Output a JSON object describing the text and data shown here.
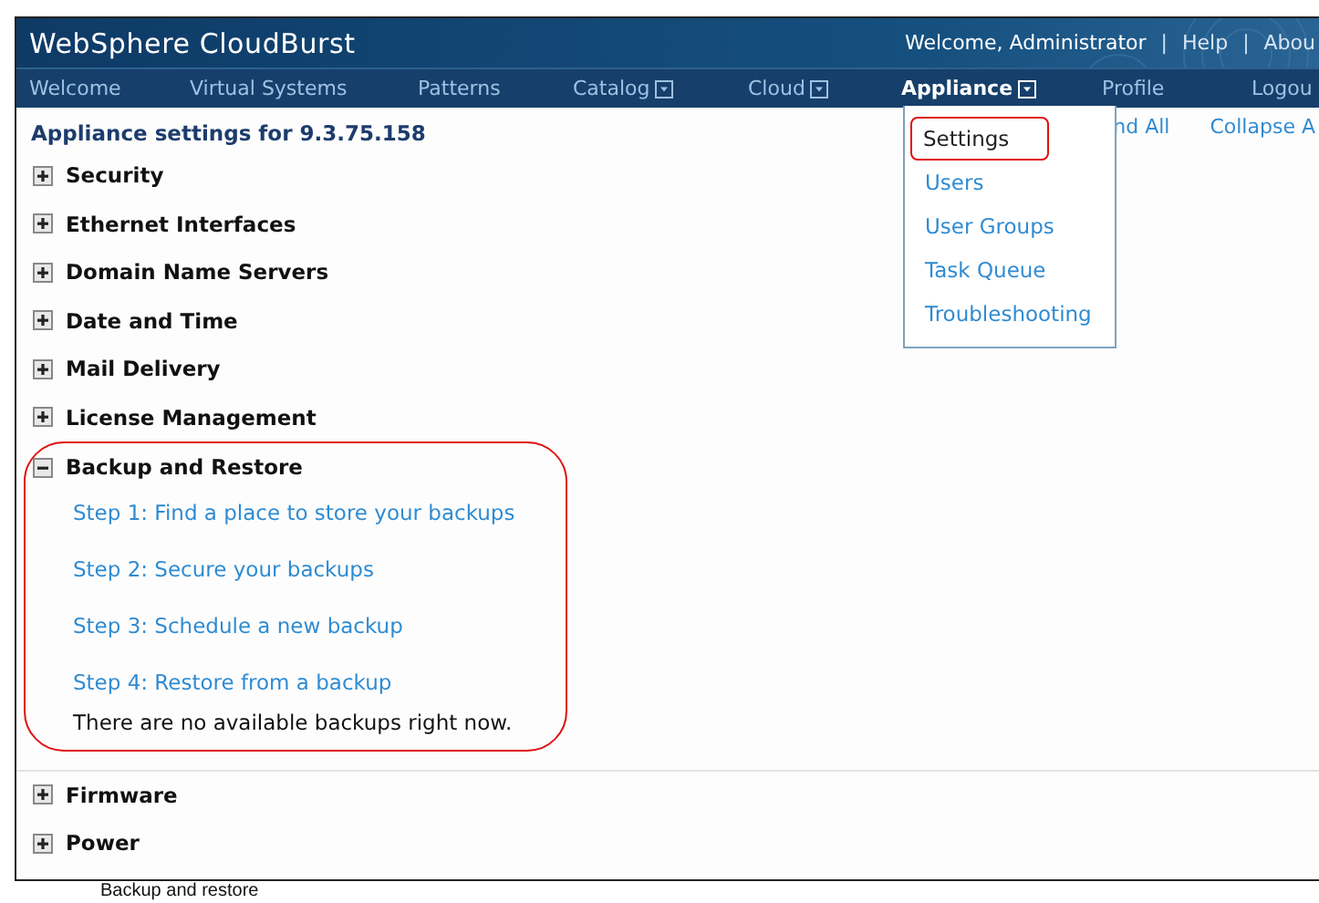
{
  "header": {
    "title": "WebSphere CloudBurst",
    "links": [
      {
        "text": "Welcome, Administrator",
        "kind": "text"
      },
      {
        "text": "|",
        "kind": "separator"
      },
      {
        "text": "Help",
        "kind": "link"
      },
      {
        "text": "|",
        "kind": "separator"
      },
      {
        "text": "Abou",
        "kind": "link"
      }
    ]
  },
  "nav": [
    {
      "label": "Welcome",
      "dropdown": false,
      "selected": false
    },
    {
      "label": "Virtual Systems",
      "dropdown": false,
      "selected": false
    },
    {
      "label": "Patterns",
      "dropdown": false,
      "selected": false
    },
    {
      "label": "Catalog",
      "dropdown": true,
      "selected": false
    },
    {
      "label": "Cloud",
      "dropdown": true,
      "selected": false
    },
    {
      "label": "Appliance",
      "dropdown": true,
      "selected": true
    },
    {
      "label": "Profile",
      "dropdown": false,
      "selected": false
    },
    {
      "label": "Logou",
      "dropdown": false,
      "selected": false
    }
  ],
  "menu": {
    "items": [
      {
        "label": "Settings",
        "highlighted": true
      },
      {
        "label": "Users",
        "highlighted": false
      },
      {
        "label": "User Groups",
        "highlighted": false
      },
      {
        "label": "Task Queue",
        "highlighted": false
      },
      {
        "label": "Troubleshooting",
        "highlighted": false
      }
    ]
  },
  "page": {
    "heading": "Appliance settings for 9.3.75.158",
    "actions": [
      "nd All",
      "Collapse A"
    ]
  },
  "sections": [
    {
      "title": "Security",
      "expanded": false,
      "highlighted": false
    },
    {
      "title": "Ethernet Interfaces",
      "expanded": false,
      "highlighted": false
    },
    {
      "title": "Domain Name Servers",
      "expanded": false,
      "highlighted": false
    },
    {
      "title": "Date and Time",
      "expanded": false,
      "highlighted": false
    },
    {
      "title": "Mail Delivery",
      "expanded": false,
      "highlighted": false
    },
    {
      "title": "License Management",
      "expanded": false,
      "highlighted": false
    },
    {
      "title": "Backup and Restore",
      "expanded": true,
      "highlighted": true,
      "links": [
        "Step 1: Find a place to store your backups",
        "Step 2: Secure your backups",
        "Step 3: Schedule a new backup",
        "Step 4: Restore from a backup"
      ],
      "note": "There are no available backups right now."
    },
    {
      "title": "Firmware",
      "expanded": false,
      "highlighted": false
    },
    {
      "title": "Power",
      "expanded": false,
      "highlighted": false
    }
  ],
  "caption": "Backup and restore"
}
